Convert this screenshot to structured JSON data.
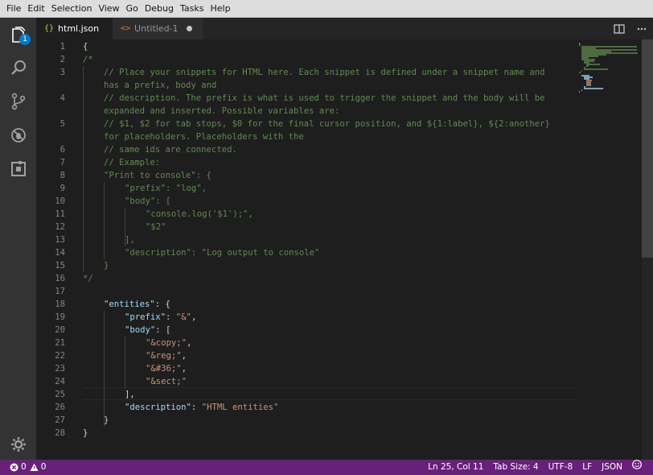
{
  "menubar": {
    "items": [
      "File",
      "Edit",
      "Selection",
      "View",
      "Go",
      "Debug",
      "Tasks",
      "Help"
    ]
  },
  "activity_bar": {
    "explorer_badge": "1",
    "icons": [
      "files-icon",
      "search-icon",
      "source-control-icon",
      "debug-icon",
      "extensions-icon",
      "settings-gear-icon"
    ]
  },
  "tabs": [
    {
      "label": "html.json",
      "icon": "{}",
      "active": true,
      "dirty": false
    },
    {
      "label": "Untitled-1",
      "icon": "<>",
      "active": false,
      "dirty": true
    }
  ],
  "editor": {
    "lines": [
      {
        "n": "1",
        "indent": 0,
        "kind": "punc",
        "text": "{"
      },
      {
        "n": "2",
        "indent": 0,
        "kind": "comment",
        "text": "/*"
      },
      {
        "n": "3",
        "indent": 1,
        "kind": "comment",
        "text": "// Place your snippets for HTML here. Each snippet is defined under a snippet name and"
      },
      {
        "n": "",
        "indent": 1,
        "kind": "comment",
        "text": "has a prefix, body and"
      },
      {
        "n": "4",
        "indent": 1,
        "kind": "comment",
        "text": "// description. The prefix is what is used to trigger the snippet and the body will be"
      },
      {
        "n": "",
        "indent": 1,
        "kind": "comment",
        "text": "expanded and inserted. Possible variables are:"
      },
      {
        "n": "5",
        "indent": 1,
        "kind": "comment",
        "text": "// $1, $2 for tab stops, $0 for the final cursor position, and ${1:label}, ${2:another}"
      },
      {
        "n": "",
        "indent": 1,
        "kind": "comment",
        "text": "for placeholders. Placeholders with the"
      },
      {
        "n": "6",
        "indent": 1,
        "kind": "comment",
        "text": "// same ids are connected."
      },
      {
        "n": "7",
        "indent": 1,
        "kind": "comment",
        "text": "// Example:"
      },
      {
        "n": "8",
        "indent": 1,
        "kind": "comment",
        "text": "\"Print to console\": {"
      },
      {
        "n": "9",
        "indent": 2,
        "kind": "comment",
        "text": "\"prefix\": \"log\","
      },
      {
        "n": "10",
        "indent": 2,
        "kind": "comment",
        "text": "\"body\": ["
      },
      {
        "n": "11",
        "indent": 3,
        "kind": "comment",
        "text": "\"console.log('$1');\","
      },
      {
        "n": "12",
        "indent": 3,
        "kind": "comment",
        "text": "\"$2\""
      },
      {
        "n": "13",
        "indent": 2,
        "kind": "comment",
        "text": "],"
      },
      {
        "n": "14",
        "indent": 2,
        "kind": "comment",
        "text": "\"description\": \"Log output to console\""
      },
      {
        "n": "15",
        "indent": 1,
        "kind": "comment",
        "text": "}"
      },
      {
        "n": "16",
        "indent": 0,
        "kind": "comment",
        "text": "*/"
      },
      {
        "n": "17",
        "indent": 0,
        "kind": "punc",
        "text": ""
      },
      {
        "n": "18",
        "indent": 1,
        "kind": "kv",
        "key": "\"entities\"",
        "rest": ": {"
      },
      {
        "n": "19",
        "indent": 2,
        "kind": "kvs",
        "key": "\"prefix\"",
        "sep": ": ",
        "val": "\"&\"",
        "tail": ","
      },
      {
        "n": "20",
        "indent": 2,
        "kind": "kv",
        "key": "\"body\"",
        "rest": ": ["
      },
      {
        "n": "21",
        "indent": 3,
        "kind": "str",
        "val": "\"&copy;\"",
        "tail": ","
      },
      {
        "n": "22",
        "indent": 3,
        "kind": "str",
        "val": "\"&reg;\"",
        "tail": ","
      },
      {
        "n": "23",
        "indent": 3,
        "kind": "str",
        "val": "\"&#36;\"",
        "tail": ","
      },
      {
        "n": "24",
        "indent": 3,
        "kind": "str",
        "val": "\"&sect;\"",
        "tail": ""
      },
      {
        "n": "25",
        "indent": 2,
        "kind": "punc",
        "text": "],"
      },
      {
        "n": "26",
        "indent": 2,
        "kind": "kvs",
        "key": "\"description\"",
        "sep": ": ",
        "val": "\"HTML entities\"",
        "tail": ""
      },
      {
        "n": "27",
        "indent": 1,
        "kind": "punc",
        "text": "}"
      },
      {
        "n": "28",
        "indent": 0,
        "kind": "punc",
        "text": "}"
      }
    ]
  },
  "statusbar": {
    "errors": "0",
    "warnings": "0",
    "position": "Ln 25, Col 11",
    "tab_size": "Tab Size: 4",
    "encoding": "UTF-8",
    "eol": "LF",
    "language": "JSON"
  },
  "colors": {
    "statusbar": "#68217a",
    "comment": "#608b4e",
    "key": "#9cdcfe",
    "string": "#ce9178",
    "badge": "#007acc"
  }
}
